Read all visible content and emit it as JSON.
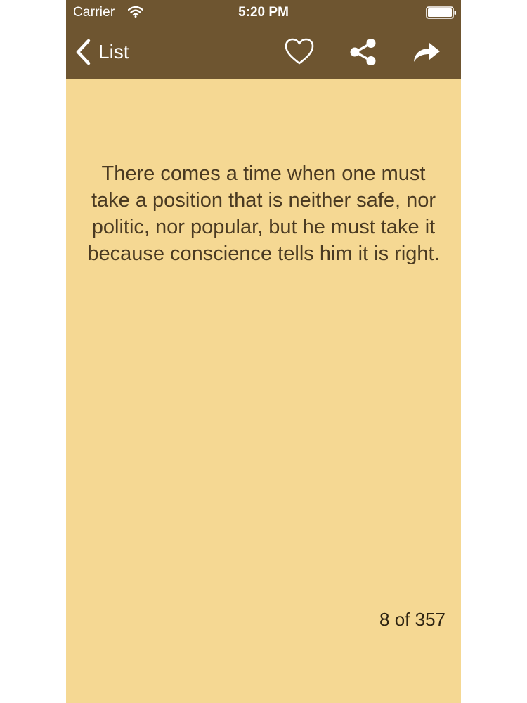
{
  "status_bar": {
    "carrier": "Carrier",
    "time": "5:20 PM"
  },
  "nav": {
    "back_label": "List",
    "icons": [
      "chevron-left-icon",
      "heart-icon",
      "share-icon",
      "forward-arrow-icon"
    ]
  },
  "quote": {
    "text": "There comes a time when one must take a position that is neither safe, nor politic, nor popular, but he must take it because conscience tells him it is right."
  },
  "pager": {
    "position": "8 of 357"
  },
  "colors": {
    "header": "#6e5530",
    "background": "#f5d893",
    "quote_text": "#4a3a22"
  }
}
